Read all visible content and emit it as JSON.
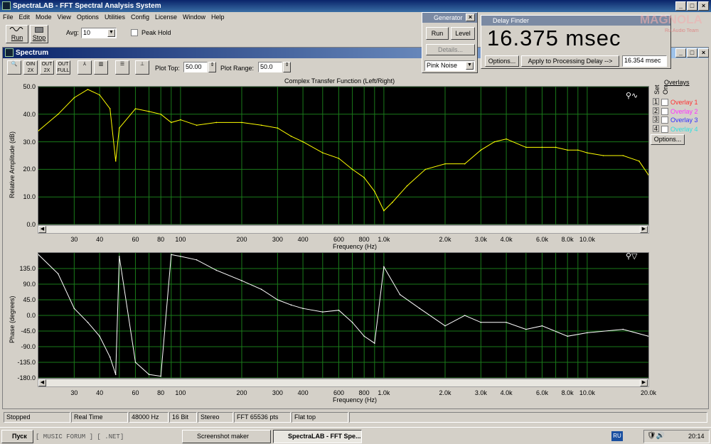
{
  "window": {
    "title": "SpectraLAB - FFT Spectral Analysis System"
  },
  "menu": [
    "File",
    "Edit",
    "Mode",
    "View",
    "Options",
    "Utilities",
    "Config",
    "License",
    "Window",
    "Help"
  ],
  "toolbar": {
    "run_label": "Run",
    "stop_label": "Stop",
    "avg_label": "Avg:",
    "avg_value": "10",
    "peak_hold_label": "Peak Hold"
  },
  "spectrum": {
    "title": "Spectrum",
    "plot_top_label": "Plot Top:",
    "plot_top_value": "50.00",
    "plot_range_label": "Plot Range:",
    "plot_range_value": "50.0",
    "chart_title": "Complex Transfer Function (Left/Right)",
    "icons": [
      "zoom-icon",
      "zoom-in-icon",
      "zoom-out-icon",
      "zoom-full-icon",
      "line-plot-icon",
      "bar-plot-icon",
      "list-icon",
      "cursor-icon"
    ],
    "icon_labels": [
      "",
      "OIN\n2X",
      "OUT\n2X",
      "OUT\nFULL",
      "",
      "",
      "",
      ""
    ]
  },
  "overlays": {
    "header": "Overlays",
    "col_set": "Set",
    "col_on": "On",
    "items": [
      {
        "num": "1",
        "label": "Overlay 1",
        "color": "#ff3030"
      },
      {
        "num": "2",
        "label": "Overlay 2",
        "color": "#ff30ff"
      },
      {
        "num": "3",
        "label": "Overlay 3",
        "color": "#3030ff"
      },
      {
        "num": "4",
        "label": "Overlay 4",
        "color": "#30e0e0"
      }
    ],
    "options_label": "Options..."
  },
  "generator": {
    "title": "Generator",
    "run_label": "Run",
    "level_label": "Level",
    "details_label": "Details...",
    "signal_value": "Pink Noise"
  },
  "delay_finder": {
    "title": "Delay Finder",
    "value": "16.375 msec",
    "options_label": "Options...",
    "apply_label": "Apply to Processing Delay -->",
    "processing_delay": "16.354 msec"
  },
  "watermark": {
    "text": "MAGNOLA",
    "subtext": "Ru.Audio Team"
  },
  "status": {
    "state": "Stopped",
    "mode": "Real Time",
    "rate": "48000 Hz",
    "bits": "16 Bit",
    "channels": "Stereo",
    "fft": "FFT 65536 pts",
    "window": "Flat top"
  },
  "taskbar": {
    "start_label": "Пуск",
    "quick_text": "[ MUSIC FORUM ] [ .NET]",
    "tasks": [
      "Screenshot maker",
      "SpectraLAB - FFT Spe..."
    ],
    "lang": "RU",
    "clock": "20:14"
  },
  "chart_data": [
    {
      "type": "line",
      "title": "Complex Transfer Function (Left/Right)",
      "xlabel": "Frequency (Hz)",
      "ylabel": "Relative Amplitude (dB)",
      "x_scale": "log",
      "xlim": [
        20,
        20000
      ],
      "ylim": [
        0,
        50
      ],
      "yticks": [
        "50.0",
        "40.0",
        "30.0",
        "20.0",
        "10.0",
        "0.0"
      ],
      "xticks": [
        "30",
        "40",
        "60",
        "80",
        "100",
        "200",
        "300",
        "400",
        "600",
        "800",
        "1.0k",
        "2.0k",
        "3.0k",
        "4.0k",
        "6.0k",
        "8.0k",
        "10.0k"
      ],
      "grid": true,
      "color": "#ffff00",
      "series": [
        {
          "x": [
            20,
            25,
            30,
            35,
            40,
            45,
            48,
            50,
            60,
            70,
            80,
            90,
            100,
            120,
            150,
            200,
            250,
            300,
            350,
            400,
            500,
            600,
            700,
            800,
            900,
            1000,
            1100,
            1300,
            1600,
            2000,
            2500,
            3000,
            3500,
            4000,
            5000,
            6000,
            7000,
            8000,
            9000,
            10000,
            12000,
            15000,
            18000,
            20000
          ],
          "values": [
            34,
            40,
            46,
            49,
            47,
            42,
            23,
            35,
            42,
            41,
            40,
            37,
            38,
            36,
            37,
            37,
            36,
            35,
            32,
            30,
            26,
            24,
            20,
            17,
            12,
            5,
            8,
            14,
            20,
            22,
            22,
            27,
            30,
            31,
            28,
            28,
            28,
            27,
            27,
            26,
            25,
            25,
            23,
            18
          ]
        }
      ]
    },
    {
      "type": "line",
      "xlabel": "Frequency (Hz)",
      "ylabel": "Phase (degrees)",
      "x_scale": "log",
      "xlim": [
        20,
        20000
      ],
      "ylim": [
        -180,
        180
      ],
      "yticks": [
        "135.0",
        "90.0",
        "45.0",
        "0.0",
        "-45.0",
        "-90.0",
        "-135.0",
        "-180.0"
      ],
      "xticks": [
        "30",
        "40",
        "60",
        "80",
        "100",
        "200",
        "300",
        "400",
        "600",
        "800",
        "1.0k",
        "2.0k",
        "3.0k",
        "4.0k",
        "6.0k",
        "8.0k",
        "10.0k",
        "20.0k"
      ],
      "grid": true,
      "color": "#ffffff",
      "series": [
        {
          "x": [
            20,
            25,
            30,
            35,
            40,
            45,
            48,
            50,
            60,
            70,
            80,
            90,
            100,
            120,
            150,
            200,
            250,
            300,
            350,
            400,
            500,
            600,
            700,
            800,
            900,
            1000,
            1200,
            1500,
            2000,
            2500,
            3000,
            4000,
            5000,
            6000,
            8000,
            10000,
            15000,
            20000
          ],
          "values": [
            175,
            120,
            20,
            -20,
            -60,
            -120,
            -170,
            170,
            -135,
            -170,
            -175,
            175,
            170,
            160,
            130,
            100,
            75,
            45,
            30,
            20,
            10,
            15,
            -20,
            -60,
            -80,
            140,
            60,
            20,
            -30,
            0,
            -20,
            -20,
            -40,
            -30,
            -60,
            -50,
            -40,
            -60
          ]
        }
      ]
    }
  ]
}
